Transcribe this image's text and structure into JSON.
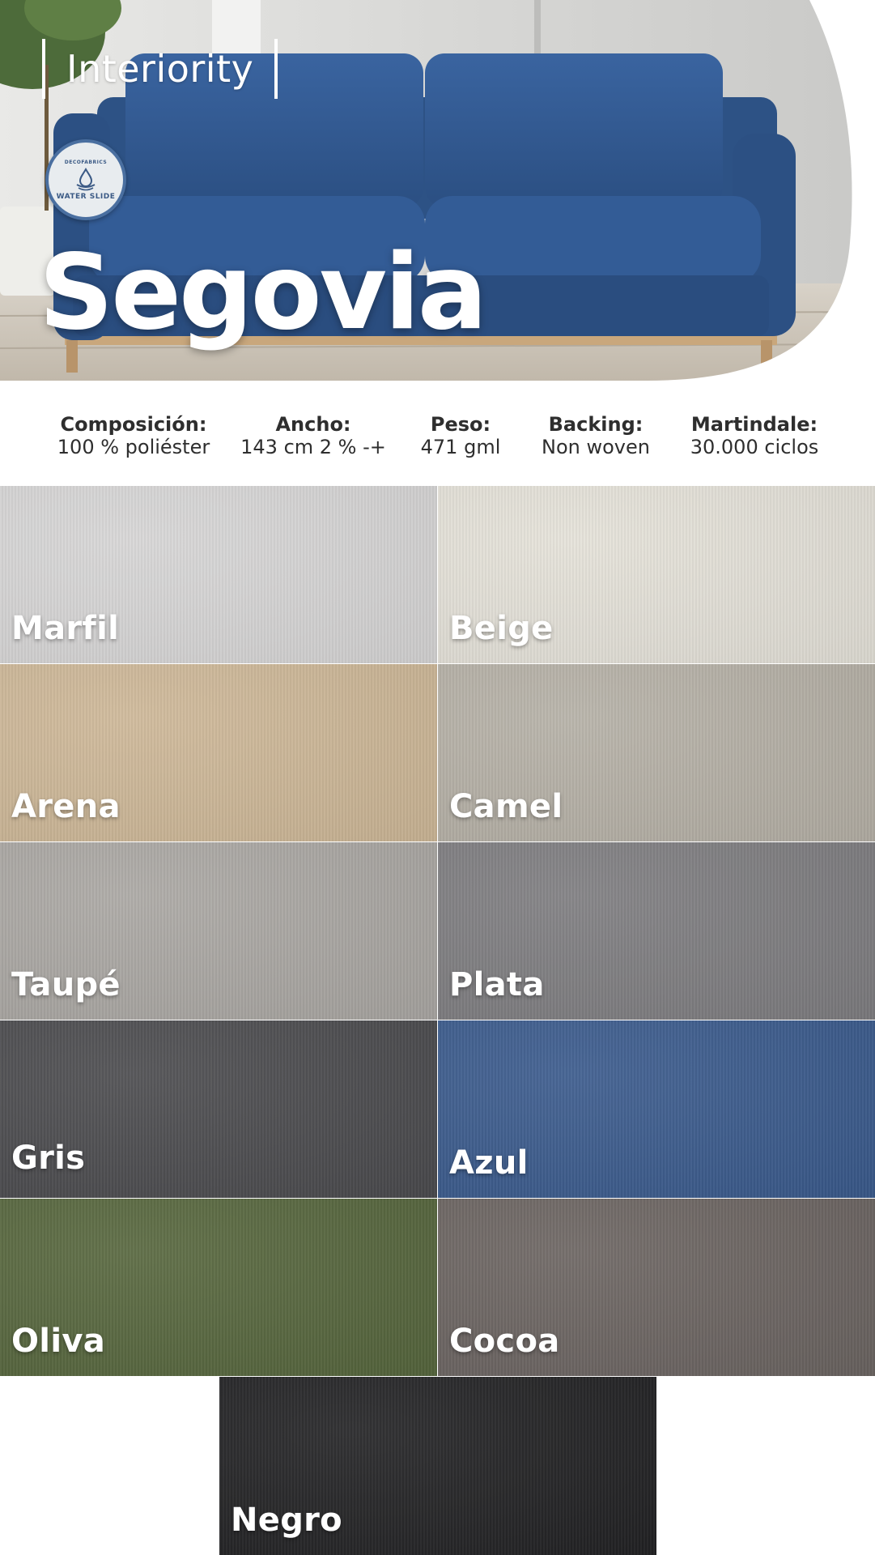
{
  "brand": {
    "name": "Interiority"
  },
  "badge": {
    "top_text": "DECOFABRICS",
    "bottom_text": "WATER SLIDE"
  },
  "product": {
    "title": "Segovia"
  },
  "specs": [
    {
      "label": "Composición:",
      "value": "100 % poliéster"
    },
    {
      "label": "Ancho:",
      "value": "143 cm 2 % -+"
    },
    {
      "label": "Peso:",
      "value": "471 gml"
    },
    {
      "label": "Backing:",
      "value": "Non woven"
    },
    {
      "label": "Martindale:",
      "value": "30.000 ciclos"
    }
  ],
  "swatches": [
    {
      "name": "Marfil",
      "color": "#d6d5d5"
    },
    {
      "name": "Beige",
      "color": "#e4e1d8"
    },
    {
      "name": "Arena",
      "color": "#cdb797"
    },
    {
      "name": "Camel",
      "color": "#b5b0a6"
    },
    {
      "name": "Taupé",
      "color": "#aaa7a3"
    },
    {
      "name": "Plata",
      "color": "#7e7d80"
    },
    {
      "name": "Gris",
      "color": "#4b4b4e"
    },
    {
      "name": "Azul",
      "color": "#3a5a8c"
    },
    {
      "name": "Oliva",
      "color": "#56663d"
    },
    {
      "name": "Cocoa",
      "color": "#6b6461"
    },
    {
      "name": "Negro",
      "color": "#222224"
    }
  ],
  "colors": {
    "sofa": "#2f5587",
    "hero_wall": "#dcdcda",
    "floor": "#cfc8bd"
  }
}
